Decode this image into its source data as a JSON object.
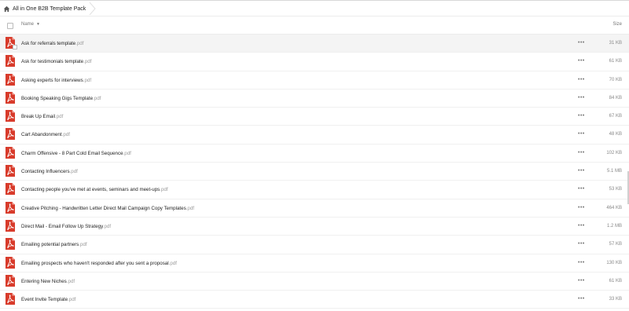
{
  "breadcrumb": {
    "folder": "All in One B2B Template Pack",
    "icon": "home-icon"
  },
  "header": {
    "name_label": "Name",
    "size_label": "Size"
  },
  "colors": {
    "pdf_red": "#d83b2b",
    "text": "#222222",
    "muted": "#9a9a9a"
  },
  "files": [
    {
      "name": "Ask for referrals template",
      "ext": ".pdf",
      "size": "31 KB"
    },
    {
      "name": "Ask for testimonials template",
      "ext": ".pdf",
      "size": "61 KB"
    },
    {
      "name": "Asking experts for interviews",
      "ext": ".pdf",
      "size": "70 KB"
    },
    {
      "name": "Booking Speaking Gigs Template",
      "ext": ".pdf",
      "size": "84 KB"
    },
    {
      "name": "Break Up Email",
      "ext": ".pdf",
      "size": "67 KB"
    },
    {
      "name": "Cart Abandonment",
      "ext": ".pdf",
      "size": "48 KB"
    },
    {
      "name": "Charm Offensive - 8 Part Cold Email Sequence",
      "ext": ".pdf",
      "size": "102 KB"
    },
    {
      "name": "Contacting Influencers",
      "ext": ".pdf",
      "size": "5.1 MB"
    },
    {
      "name": "Contacting people you've met at events, seminars and meet-ups",
      "ext": ".pdf",
      "size": "53 KB"
    },
    {
      "name": "Creative Pitching - Handwritten Letter Direct Mail Campaign Copy Templates",
      "ext": ".pdf",
      "size": "464 KB"
    },
    {
      "name": "Direct Mail - Email Follow Up Strategy",
      "ext": ".pdf",
      "size": "1.2 MB"
    },
    {
      "name": "Emailing potential partners",
      "ext": ".pdf",
      "size": "57 KB"
    },
    {
      "name": "Emailing prospects who haven't responded after you sent a proposal",
      "ext": ".pdf",
      "size": "130 KB"
    },
    {
      "name": "Entering New Niches",
      "ext": ".pdf",
      "size": "61 KB"
    },
    {
      "name": "Event Invite Template",
      "ext": ".pdf",
      "size": "33 KB"
    }
  ]
}
